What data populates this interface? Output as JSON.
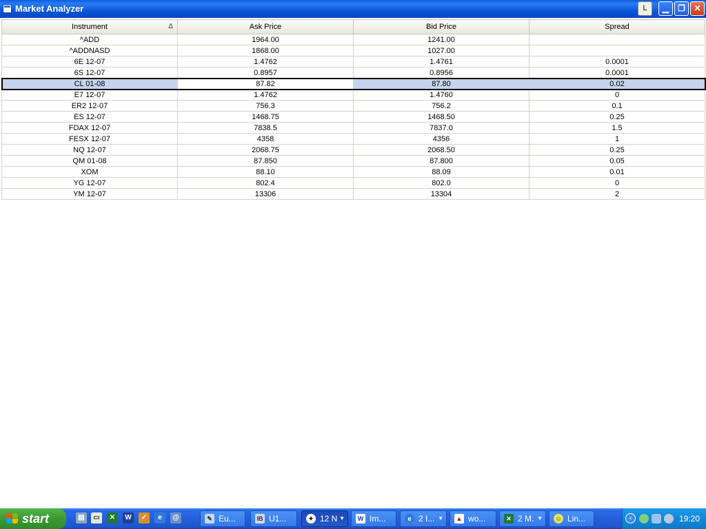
{
  "window": {
    "title": "Market Analyzer",
    "layout_button": "L"
  },
  "table": {
    "columns": [
      "Instrument",
      "Ask Price",
      "Bid Price",
      "Spread"
    ],
    "sort_indicator": "Δ",
    "rows": [
      {
        "instrument": "^ADD",
        "ask": "1964.00",
        "bid": "1241.00",
        "spread": ""
      },
      {
        "instrument": "^ADDNASD",
        "ask": "1868.00",
        "bid": "1027.00",
        "spread": ""
      },
      {
        "instrument": "6E 12-07",
        "ask": "1.4762",
        "bid": "1.4761",
        "spread": "0.0001"
      },
      {
        "instrument": "6S 12-07",
        "ask": "0.8957",
        "bid": "0.8956",
        "spread": "0.0001"
      },
      {
        "instrument": "CL 01-08",
        "ask": "87.82",
        "bid": "87.80",
        "spread": "0.02"
      },
      {
        "instrument": "E7 12-07",
        "ask": "1.4762",
        "bid": "1.4760",
        "spread": "0"
      },
      {
        "instrument": "ER2 12-07",
        "ask": "756.3",
        "bid": "756.2",
        "spread": "0.1"
      },
      {
        "instrument": "ES 12-07",
        "ask": "1468.75",
        "bid": "1468.50",
        "spread": "0.25"
      },
      {
        "instrument": "FDAX 12-07",
        "ask": "7838.5",
        "bid": "7837.0",
        "spread": "1.5"
      },
      {
        "instrument": "FESX 12-07",
        "ask": "4358",
        "bid": "4356",
        "spread": "1"
      },
      {
        "instrument": "NQ 12-07",
        "ask": "2068.75",
        "bid": "2068.50",
        "spread": "0.25"
      },
      {
        "instrument": "QM 01-08",
        "ask": "87.850",
        "bid": "87.800",
        "spread": "0.05"
      },
      {
        "instrument": "XOM",
        "ask": "88.10",
        "bid": "88.09",
        "spread": "0.01"
      },
      {
        "instrument": "YG 12-07",
        "ask": "802.4",
        "bid": "802.0",
        "spread": "0"
      },
      {
        "instrument": "YM 12-07",
        "ask": "13306",
        "bid": "13304",
        "spread": "2"
      }
    ]
  },
  "taskbar": {
    "start_label": "start",
    "tasks": [
      {
        "label": "Eu..."
      },
      {
        "label": "U1..."
      },
      {
        "label": "12 N"
      },
      {
        "label": "Im..."
      },
      {
        "label": "2 I..."
      },
      {
        "label": "wo..."
      },
      {
        "label": "2 M."
      },
      {
        "label": "Lin..."
      }
    ],
    "clock": "19:20"
  },
  "colors": {
    "selected_row": "#c5d3ec",
    "titlebar": "#0a58d8",
    "taskbar": "#245edb",
    "start_button": "#3a9a32"
  }
}
